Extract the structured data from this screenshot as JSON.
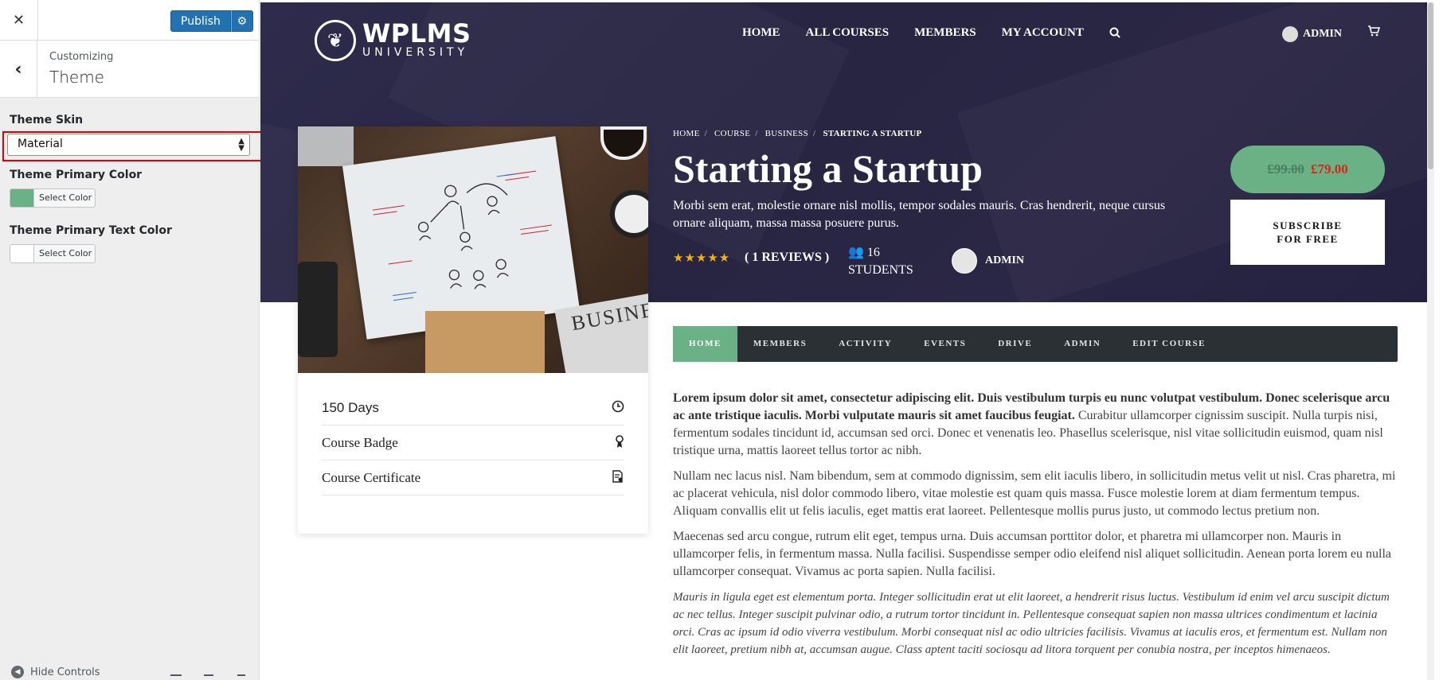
{
  "customizer": {
    "close_label": "✕",
    "publish_label": "Publish",
    "section_small": "Customizing",
    "section_title": "Theme",
    "skin_label": "Theme Skin",
    "skin_value": "Material",
    "primary_color_label": "Theme Primary Color",
    "primary_color_button": "Select Color",
    "primary_color_value": "#6ab186",
    "primary_text_color_label": "Theme Primary Text Color",
    "primary_text_color_button": "Select Color",
    "primary_text_color_value": "#ffffff",
    "hide_controls_label": "Hide Controls"
  },
  "site": {
    "logo_line1": "WPLMS",
    "logo_line2": "UNIVERSITY",
    "nav": [
      "HOME",
      "ALL COURSES",
      "MEMBERS",
      "MY ACCOUNT"
    ],
    "user_label": "ADMIN"
  },
  "course": {
    "breadcrumb": [
      "HOME",
      "COURSE",
      "BUSINESS",
      "STARTING A STARTUP"
    ],
    "title": "Starting a Startup",
    "description": "Morbi sem erat, molestie ornare nisl mollis, tempor sodales mauris. Cras hendrerit, neque cursus ornare aliquam, massa massa posuere purus.",
    "rating_stars": 5,
    "reviews_label": "( 1 REVIEWS )",
    "students_count": "16",
    "students_label": "STUDENTS",
    "instructor": "ADMIN",
    "old_price": "£99.00",
    "new_price": "£79.00",
    "subscribe_line1": "SUBSCRIBE",
    "subscribe_line2": "FOR FREE",
    "image_newspaper_text": "BUSINE",
    "details": [
      {
        "label": "150 Days",
        "icon": "clock-icon"
      },
      {
        "label": "Course Badge",
        "icon": "badge-icon"
      },
      {
        "label": "Course Certificate",
        "icon": "certificate-icon"
      }
    ],
    "tabs": [
      "HOME",
      "MEMBERS",
      "ACTIVITY",
      "EVENTS",
      "DRIVE",
      "ADMIN",
      "EDIT COURSE"
    ],
    "content": {
      "p1_bold": "Lorem ipsum dolor sit amet, consectetur adipiscing elit. Duis vestibulum turpis eu nunc volutpat vestibulum. Donec scelerisque arcu ac ante tristique iaculis. Morbi vulputate mauris sit amet faucibus feugiat.",
      "p1_rest": " Curabitur ullamcorper cignissim suscipit. Nulla turpis nisi, fermentum sodales tincidunt id, accumsan sed orci. Donec et venenatis leo. Phasellus scelerisque, nisl vitae sollicitudin euismod, quam nisl tristique urna, mattis laoreet tellus tortor ac nibh.",
      "p2": "Nullam nec lacus nisl. Nam bibendum, sem at commodo dignissim, sem elit iaculis libero, in sollicitudin metus velit ut nisl. Cras pharetra, mi ac placerat vehicula, nisl dolor commodo libero, vitae molestie est quam quis massa. Fusce molestie lorem at diam fermentum tempus. Aliquam convallis elit ut felis iaculis, eget mattis erat laoreet. Pellentesque mollis purus justo, ut commodo lectus pretium non.",
      "p3": "Maecenas sed arcu congue, rutrum elit eget, tempus urna. Duis accumsan porttitor dolor, et pharetra mi ullamcorper non. Mauris in ullamcorper felis, in fermentum massa. Nulla facilisi. Suspendisse semper odio eleifend nisl aliquet sollicitudin. Aenean porta lorem eu nulla ullamcorper consequat. Vivamus ac porta sapien. Nulla facilisi.",
      "p4": "Mauris in ligula eget est elementum porta. Integer sollicitudin erat ut elit laoreet, a hendrerit risus luctus. Vestibulum id enim vel arcu suscipit dictum ac nec tellus. Integer suscipit pulvinar odio, a rutrum tortor tincidunt in. Pellentesque consequat sapien non massa ultrices condimentum et lacinia orci. Cras ac ipsum id odio viverra vestibulum. Morbi consequat nisl ac odio ultricies facilisis. Vivamus at iaculis eros, et fermentum est. Nullam non elit laoreet, pretium nibh at, accumsan augue. Class aptent taciti sociosqu ad litora torquent per conubia nostra, per inceptos himenaeos."
    }
  },
  "colors": {
    "accent": "#6ab186",
    "hero_bg": "#2a2745",
    "tab_bar": "#2a3034",
    "publish_blue": "#2271b1",
    "price_red": "#d9261c",
    "highlight_red": "#e00000"
  }
}
